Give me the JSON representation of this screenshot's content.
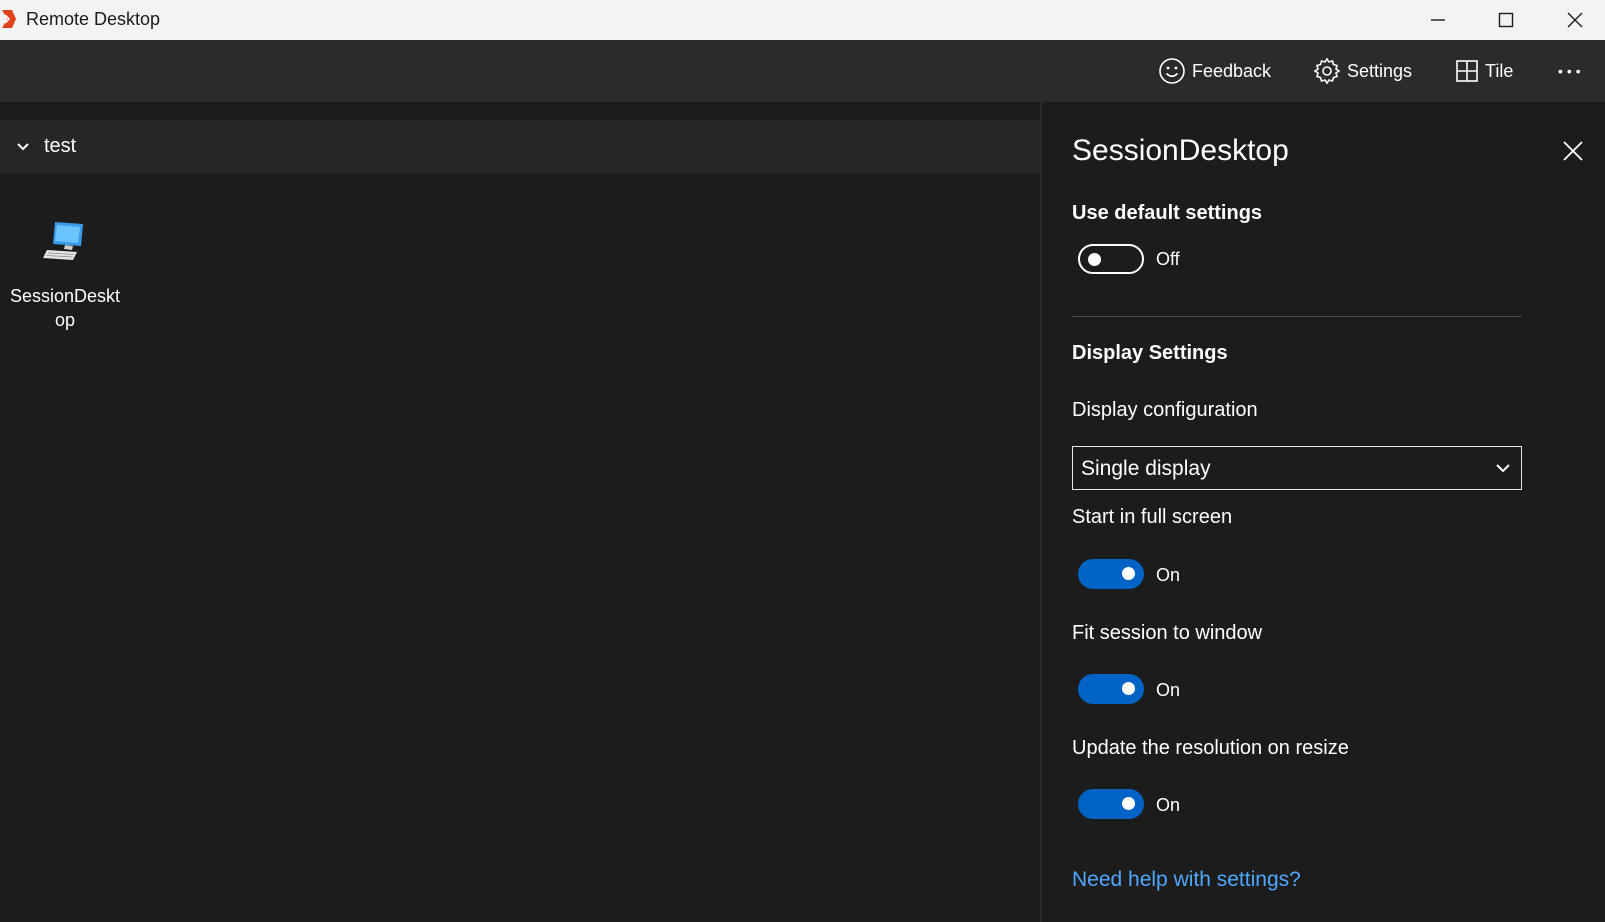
{
  "window": {
    "title": "Remote Desktop"
  },
  "toolbar": {
    "feedback_label": "Feedback",
    "settings_label": "Settings",
    "tile_label": "Tile",
    "more_label": "•••"
  },
  "group": {
    "label": "test",
    "items": [
      {
        "label": "SessionDesktop"
      }
    ]
  },
  "panel": {
    "title": "SessionDesktop",
    "use_default_settings": {
      "label": "Use default settings",
      "state": "Off"
    },
    "display_settings_title": "Display Settings",
    "display_configuration": {
      "label": "Display configuration",
      "value": "Single display"
    },
    "start_full_screen": {
      "label": "Start in full screen",
      "state": "On"
    },
    "fit_session": {
      "label": "Fit session to window",
      "state": "On"
    },
    "update_resolution": {
      "label": "Update the resolution on resize",
      "state": "On"
    },
    "help_link": "Need help with settings?"
  },
  "colors": {
    "accent": "#0063c5",
    "link": "#4ea8ff",
    "background": "#1c1c1c",
    "toolbar": "#2b2b2b",
    "titlebar": "#f3f3f3",
    "app_icon": "#e0421d"
  },
  "icons": {
    "app": "remote-desktop-icon",
    "feedback": "smiley-icon",
    "settings": "gear-icon",
    "tile": "grid-icon",
    "desktop": "monitor-icon"
  }
}
